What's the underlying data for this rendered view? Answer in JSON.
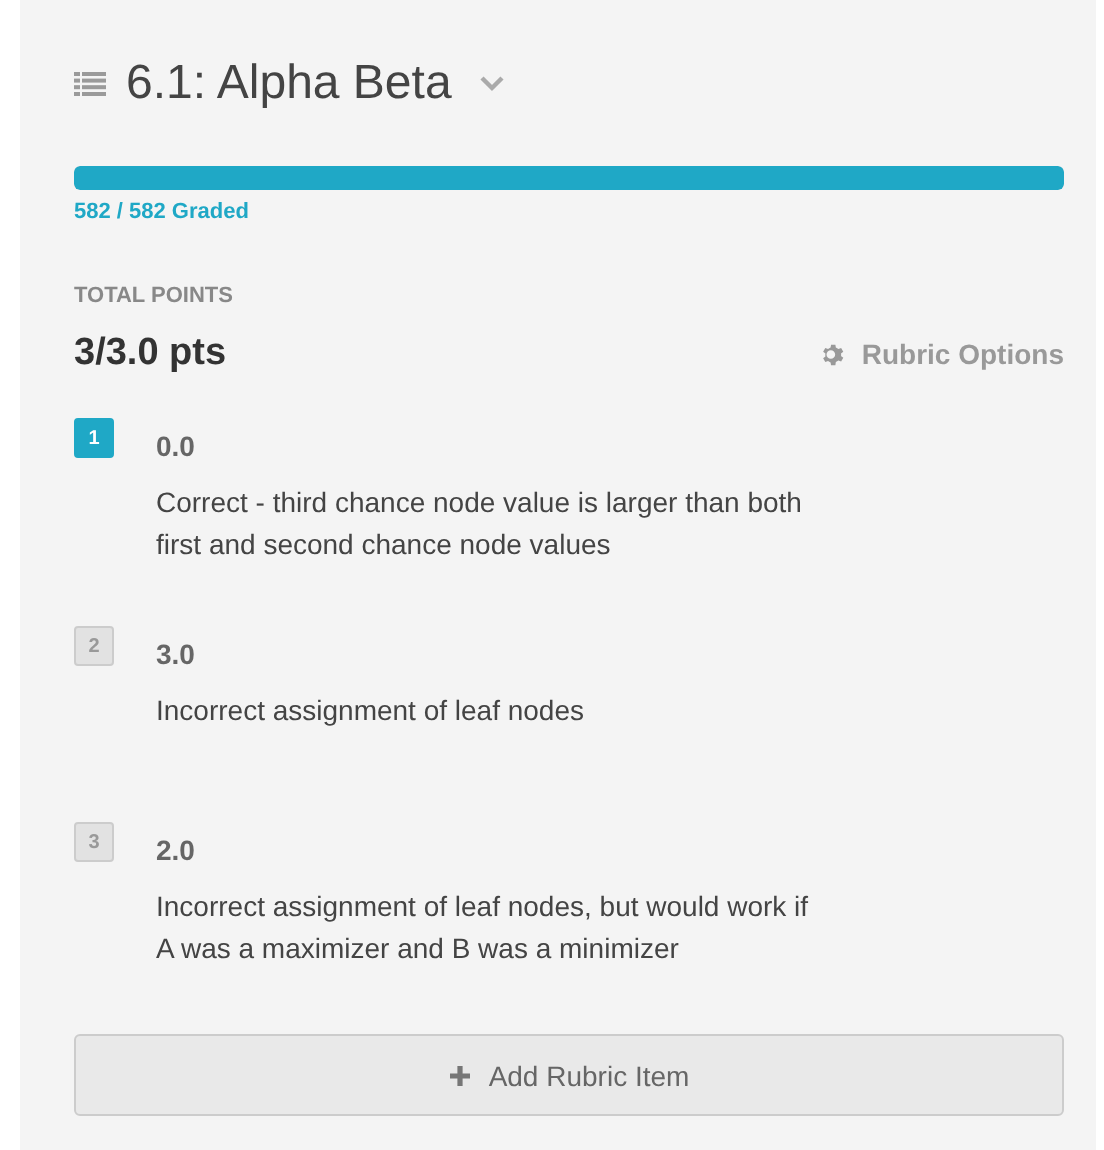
{
  "header": {
    "title": "6.1: Alpha Beta"
  },
  "progress": {
    "level": 1,
    "label": "582 / 582 Graded"
  },
  "total": {
    "label": "TOTAL POINTS",
    "value": "3/3.0 pts"
  },
  "rubric_options": {
    "label": "Rubric Options"
  },
  "rubric_items": [
    {
      "key": "1",
      "selected": true,
      "points": "0.0",
      "description": "Correct - third chance node value is larger than both first and second chance node values"
    },
    {
      "key": "2",
      "selected": false,
      "points": "3.0",
      "description": "Incorrect assignment of leaf nodes"
    },
    {
      "key": "3",
      "selected": false,
      "points": "2.0",
      "description": "Incorrect assignment of leaf nodes, but would work if A was a maximizer and B was a minimizer"
    }
  ],
  "add_button": {
    "label": "Add Rubric Item"
  }
}
